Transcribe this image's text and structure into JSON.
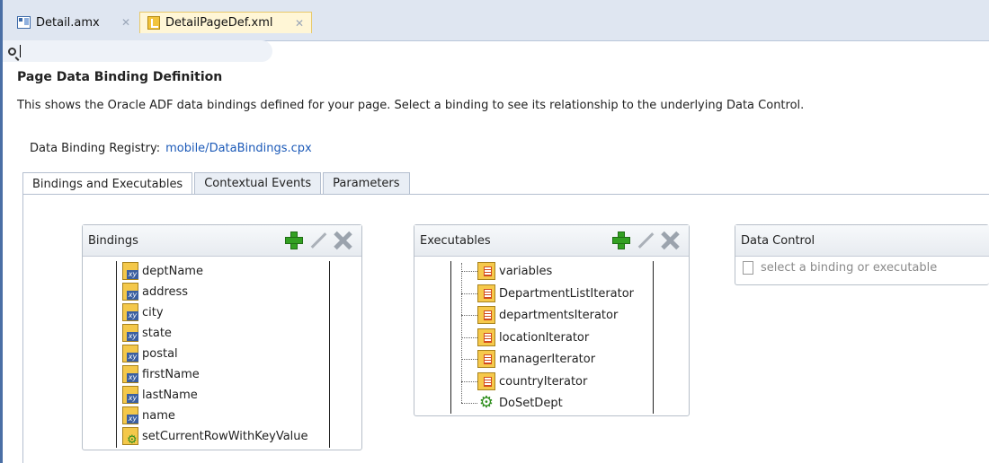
{
  "tabs": [
    {
      "label": "Detail.amx",
      "icon": "amx-file-icon"
    },
    {
      "label": "DetailPageDef.xml",
      "icon": "xml-file-icon",
      "active": true
    }
  ],
  "search": {
    "value": "",
    "icon": "search-icon"
  },
  "header": {
    "title": "Page Data Binding Definition",
    "description": "This shows the Oracle ADF data bindings defined for your page. Select a binding to see its relationship to the underlying Data Control."
  },
  "registry": {
    "label": "Data Binding Registry:",
    "link": "mobile/DataBindings.cpx"
  },
  "page_tabs": [
    "Bindings and Executables",
    "Contextual Events",
    "Parameters"
  ],
  "bindings": {
    "title": "Bindings",
    "items": [
      {
        "label": "deptName",
        "icon": "attribute-binding-icon"
      },
      {
        "label": "address",
        "icon": "attribute-binding-icon"
      },
      {
        "label": "city",
        "icon": "attribute-binding-icon"
      },
      {
        "label": "state",
        "icon": "attribute-binding-icon"
      },
      {
        "label": "postal",
        "icon": "attribute-binding-icon"
      },
      {
        "label": "firstName",
        "icon": "attribute-binding-icon"
      },
      {
        "label": "lastName",
        "icon": "attribute-binding-icon"
      },
      {
        "label": "name",
        "icon": "attribute-binding-icon"
      },
      {
        "label": "setCurrentRowWithKeyValue",
        "icon": "method-binding-icon"
      }
    ]
  },
  "executables": {
    "title": "Executables",
    "items": [
      {
        "label": "variables",
        "icon": "iterator-icon"
      },
      {
        "label": "DepartmentListIterator",
        "icon": "iterator-icon"
      },
      {
        "label": "departmentsIterator",
        "icon": "iterator-icon"
      },
      {
        "label": "locationIterator",
        "icon": "iterator-icon"
      },
      {
        "label": "managerIterator",
        "icon": "iterator-icon"
      },
      {
        "label": "countryIterator",
        "icon": "iterator-icon"
      },
      {
        "label": "DoSetDept",
        "icon": "gear-icon"
      }
    ]
  },
  "data_control": {
    "title": "Data Control",
    "placeholder": "select a binding or executable"
  }
}
